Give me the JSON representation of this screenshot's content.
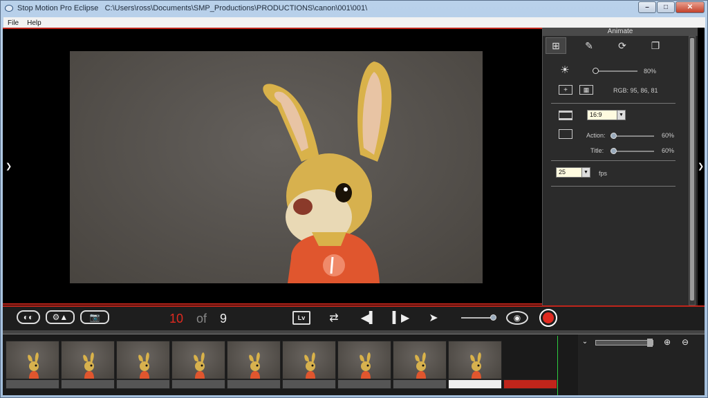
{
  "window": {
    "app_name": "Stop Motion Pro Eclipse",
    "path": "C:\\Users\\ross\\Documents\\SMP_Productions\\PRODUCTIONS\\canon\\001\\001\\",
    "minimize": "–",
    "maximize": "□",
    "close": "✕"
  },
  "menu": {
    "items": [
      "File",
      "Help"
    ]
  },
  "panel": {
    "title": "Animate",
    "brightness_value": "80%",
    "rgb": "RGB:  95, 86, 81",
    "aspect_select": "16:9",
    "action_label": "Action:",
    "action_value": "60%",
    "title_label": "Title:",
    "title_value": "60%",
    "fps_select": "25",
    "fps_label": "fps"
  },
  "controls": {
    "frame_current": "10",
    "of_label": "of",
    "frame_total": "9",
    "lv_label": "Lv"
  },
  "timeline": {
    "frame_count": 9
  },
  "colors": {
    "accent_red": "#c0251b",
    "playhead_green": "#2ecc40",
    "counter_red": "#e02a20"
  }
}
